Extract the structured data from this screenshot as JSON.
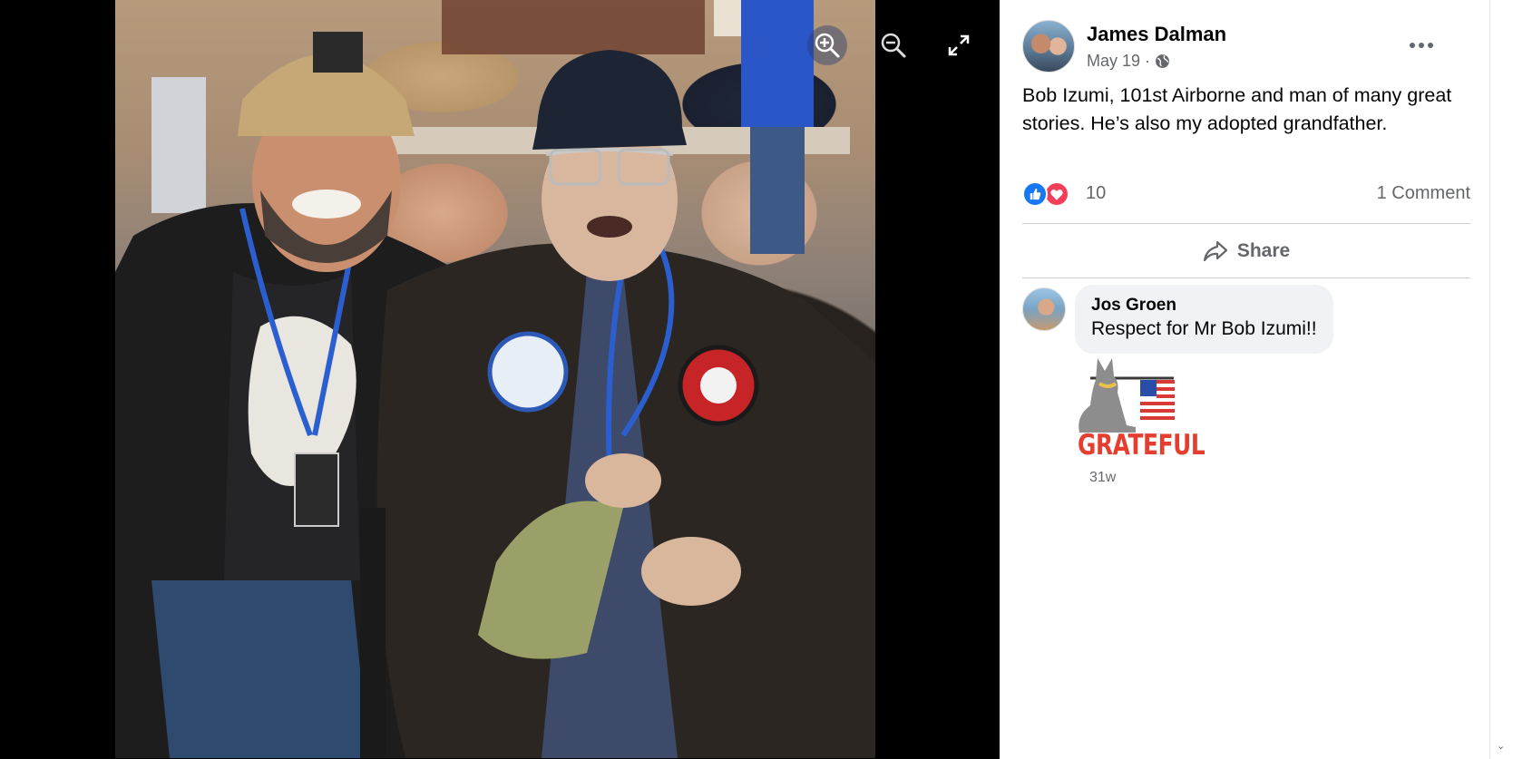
{
  "post": {
    "author": "James Dalman",
    "date": "May 19",
    "meta_sep": "·",
    "caption": "Bob Izumi, 101st Airborne and man of many great stories. He’s also my adopted grandfather.",
    "reaction_count": "10",
    "comment_count": "1 Comment",
    "share_label": "Share"
  },
  "comment": {
    "author": "Jos Groen",
    "text": "Respect for Mr Bob Izumi!!",
    "sticker_text": "GRATEFUL",
    "time": "31w"
  },
  "colors": {
    "like": "#1877f2",
    "love": "#f33e58",
    "secondary_text": "#65676b",
    "sticker_red": "#e53e2f"
  },
  "icons": [
    "zoom-in-icon",
    "zoom-out-icon",
    "fullscreen-icon",
    "globe-icon",
    "more-icon",
    "like-icon",
    "love-icon",
    "share-icon"
  ]
}
